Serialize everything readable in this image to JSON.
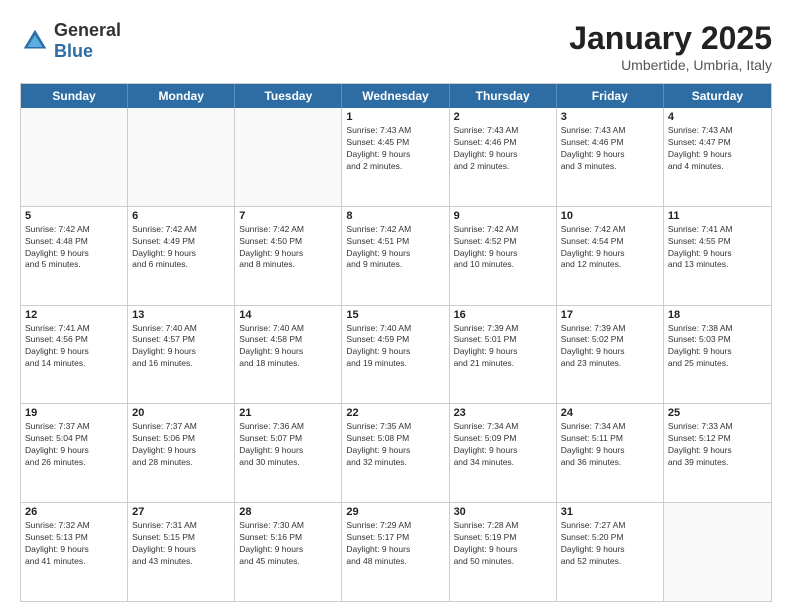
{
  "logo": {
    "general": "General",
    "blue": "Blue"
  },
  "header": {
    "month": "January 2025",
    "location": "Umbertide, Umbria, Italy"
  },
  "dayHeaders": [
    "Sunday",
    "Monday",
    "Tuesday",
    "Wednesday",
    "Thursday",
    "Friday",
    "Saturday"
  ],
  "weeks": [
    [
      {
        "day": "",
        "info": ""
      },
      {
        "day": "",
        "info": ""
      },
      {
        "day": "",
        "info": ""
      },
      {
        "day": "1",
        "info": "Sunrise: 7:43 AM\nSunset: 4:45 PM\nDaylight: 9 hours\nand 2 minutes."
      },
      {
        "day": "2",
        "info": "Sunrise: 7:43 AM\nSunset: 4:46 PM\nDaylight: 9 hours\nand 2 minutes."
      },
      {
        "day": "3",
        "info": "Sunrise: 7:43 AM\nSunset: 4:46 PM\nDaylight: 9 hours\nand 3 minutes."
      },
      {
        "day": "4",
        "info": "Sunrise: 7:43 AM\nSunset: 4:47 PM\nDaylight: 9 hours\nand 4 minutes."
      }
    ],
    [
      {
        "day": "5",
        "info": "Sunrise: 7:42 AM\nSunset: 4:48 PM\nDaylight: 9 hours\nand 5 minutes."
      },
      {
        "day": "6",
        "info": "Sunrise: 7:42 AM\nSunset: 4:49 PM\nDaylight: 9 hours\nand 6 minutes."
      },
      {
        "day": "7",
        "info": "Sunrise: 7:42 AM\nSunset: 4:50 PM\nDaylight: 9 hours\nand 8 minutes."
      },
      {
        "day": "8",
        "info": "Sunrise: 7:42 AM\nSunset: 4:51 PM\nDaylight: 9 hours\nand 9 minutes."
      },
      {
        "day": "9",
        "info": "Sunrise: 7:42 AM\nSunset: 4:52 PM\nDaylight: 9 hours\nand 10 minutes."
      },
      {
        "day": "10",
        "info": "Sunrise: 7:42 AM\nSunset: 4:54 PM\nDaylight: 9 hours\nand 12 minutes."
      },
      {
        "day": "11",
        "info": "Sunrise: 7:41 AM\nSunset: 4:55 PM\nDaylight: 9 hours\nand 13 minutes."
      }
    ],
    [
      {
        "day": "12",
        "info": "Sunrise: 7:41 AM\nSunset: 4:56 PM\nDaylight: 9 hours\nand 14 minutes."
      },
      {
        "day": "13",
        "info": "Sunrise: 7:40 AM\nSunset: 4:57 PM\nDaylight: 9 hours\nand 16 minutes."
      },
      {
        "day": "14",
        "info": "Sunrise: 7:40 AM\nSunset: 4:58 PM\nDaylight: 9 hours\nand 18 minutes."
      },
      {
        "day": "15",
        "info": "Sunrise: 7:40 AM\nSunset: 4:59 PM\nDaylight: 9 hours\nand 19 minutes."
      },
      {
        "day": "16",
        "info": "Sunrise: 7:39 AM\nSunset: 5:01 PM\nDaylight: 9 hours\nand 21 minutes."
      },
      {
        "day": "17",
        "info": "Sunrise: 7:39 AM\nSunset: 5:02 PM\nDaylight: 9 hours\nand 23 minutes."
      },
      {
        "day": "18",
        "info": "Sunrise: 7:38 AM\nSunset: 5:03 PM\nDaylight: 9 hours\nand 25 minutes."
      }
    ],
    [
      {
        "day": "19",
        "info": "Sunrise: 7:37 AM\nSunset: 5:04 PM\nDaylight: 9 hours\nand 26 minutes."
      },
      {
        "day": "20",
        "info": "Sunrise: 7:37 AM\nSunset: 5:06 PM\nDaylight: 9 hours\nand 28 minutes."
      },
      {
        "day": "21",
        "info": "Sunrise: 7:36 AM\nSunset: 5:07 PM\nDaylight: 9 hours\nand 30 minutes."
      },
      {
        "day": "22",
        "info": "Sunrise: 7:35 AM\nSunset: 5:08 PM\nDaylight: 9 hours\nand 32 minutes."
      },
      {
        "day": "23",
        "info": "Sunrise: 7:34 AM\nSunset: 5:09 PM\nDaylight: 9 hours\nand 34 minutes."
      },
      {
        "day": "24",
        "info": "Sunrise: 7:34 AM\nSunset: 5:11 PM\nDaylight: 9 hours\nand 36 minutes."
      },
      {
        "day": "25",
        "info": "Sunrise: 7:33 AM\nSunset: 5:12 PM\nDaylight: 9 hours\nand 39 minutes."
      }
    ],
    [
      {
        "day": "26",
        "info": "Sunrise: 7:32 AM\nSunset: 5:13 PM\nDaylight: 9 hours\nand 41 minutes."
      },
      {
        "day": "27",
        "info": "Sunrise: 7:31 AM\nSunset: 5:15 PM\nDaylight: 9 hours\nand 43 minutes."
      },
      {
        "day": "28",
        "info": "Sunrise: 7:30 AM\nSunset: 5:16 PM\nDaylight: 9 hours\nand 45 minutes."
      },
      {
        "day": "29",
        "info": "Sunrise: 7:29 AM\nSunset: 5:17 PM\nDaylight: 9 hours\nand 48 minutes."
      },
      {
        "day": "30",
        "info": "Sunrise: 7:28 AM\nSunset: 5:19 PM\nDaylight: 9 hours\nand 50 minutes."
      },
      {
        "day": "31",
        "info": "Sunrise: 7:27 AM\nSunset: 5:20 PM\nDaylight: 9 hours\nand 52 minutes."
      },
      {
        "day": "",
        "info": ""
      }
    ]
  ]
}
